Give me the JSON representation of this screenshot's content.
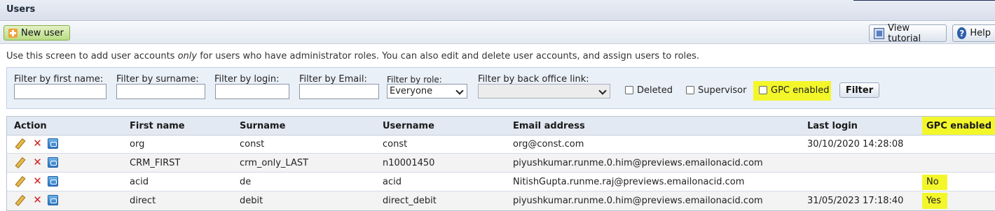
{
  "titlebar": {
    "title": "Users"
  },
  "toolbar": {
    "new_user_label": "New user",
    "view_tutorial_label": "View tutorial",
    "help_label": "Help"
  },
  "info_text": {
    "before": "Use this screen to add user accounts ",
    "emphasis": "only",
    "after": " for users who have administrator roles. You can also edit and delete user accounts, and assign users to roles."
  },
  "filters": {
    "first_name_label": "Filter by first name:",
    "first_name_value": "",
    "surname_label": "Filter by surname:",
    "surname_value": "",
    "login_label": "Filter by login:",
    "login_value": "",
    "email_label": "Filter by Email:",
    "email_value": "",
    "role_label": "Filter by role:",
    "role_value": "Everyone",
    "backoffice_label": "Filter by back office link:",
    "backoffice_value": "",
    "deleted_label": "Deleted",
    "deleted_checked": false,
    "supervisor_label": "Supervisor",
    "supervisor_checked": false,
    "gpc_label": "GPC enabled",
    "gpc_checked": false,
    "filter_button_label": "Filter"
  },
  "table": {
    "columns": [
      "Action",
      "First name",
      "Surname",
      "Username",
      "Email address",
      "Last login",
      "GPC enabled"
    ],
    "rows": [
      {
        "first_name": "org",
        "surname": "const",
        "username": "const",
        "email": "org@const.com",
        "last_login": "30/10/2020 14:28:08",
        "gpc": ""
      },
      {
        "first_name": "CRM_FIRST",
        "surname": "crm_only_LAST",
        "username": "n10001450",
        "email": "piyushkumar.runme.0.him@previews.emailonacid.com",
        "last_login": "",
        "gpc": ""
      },
      {
        "first_name": "acid",
        "surname": "de",
        "username": "acid",
        "email": "NitishGupta.runme.raj@previews.emailonacid.com",
        "last_login": "",
        "gpc": "No"
      },
      {
        "first_name": "direct",
        "surname": "debit",
        "username": "direct_debit",
        "email": "piyushkumar.runme.0.him@previews.emailonacid.com",
        "last_login": "31/05/2023 17:18:40",
        "gpc": "Yes"
      }
    ]
  },
  "icons": {
    "new_user": "plus-icon",
    "tutorial": "film-icon",
    "help": "help-icon",
    "row_actions": [
      "edit-icon",
      "delete-icon",
      "login-as-icon"
    ]
  },
  "colors": {
    "highlight": "#f3f72a",
    "delete": "#d42020",
    "new_user_button": "#b9dc85"
  }
}
